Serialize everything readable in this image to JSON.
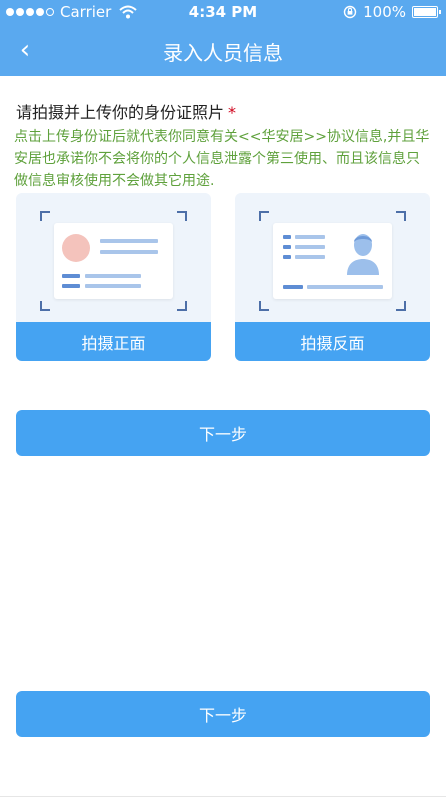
{
  "status_bar": {
    "carrier": "Carrier",
    "time": "4:34 PM",
    "battery": "100%",
    "signal_bars_filled": 4,
    "signal_bars_total": 5
  },
  "nav": {
    "back_label": "‹",
    "title": "录入人员信息"
  },
  "form": {
    "prompt": "请拍摄并上传你的身份证照片",
    "required_mark": "*",
    "agreement": "点击上传身份证后就代表你同意有关<<华安居>>协议信息,并且华安居也承诺你不会将你的个人信息泄露个第三使用、而且该信息只做信息审核使用不会做其它用途."
  },
  "cards": {
    "front_label": "拍摄正面",
    "back_label": "拍摄反面"
  },
  "buttons": {
    "next_top": "下一步",
    "next_bottom": "下一步"
  },
  "colors": {
    "primary": "#45a3f2",
    "nav": "#5aa9ef",
    "agreement_text": "#5fa13c",
    "required": "#d0021b"
  }
}
